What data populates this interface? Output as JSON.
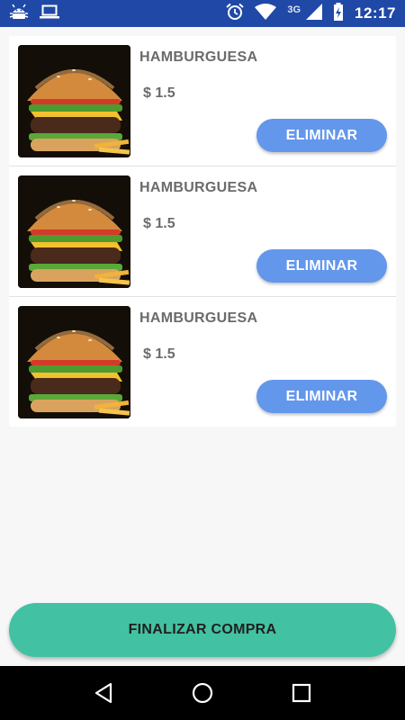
{
  "status_bar": {
    "time": "12:17",
    "network": "3G",
    "icons": [
      "android-debug-icon",
      "laptop-icon",
      "alarm-icon",
      "wifi-icon",
      "signal-icon",
      "battery-icon"
    ]
  },
  "cart": {
    "items": [
      {
        "name": "HAMBURGUESA",
        "price": "$ 1.5",
        "image": "hamburger-image",
        "remove_label": "ELIMINAR"
      },
      {
        "name": "HAMBURGUESA",
        "price": "$ 1.5",
        "image": "hamburger-image",
        "remove_label": "ELIMINAR"
      },
      {
        "name": "HAMBURGUESA",
        "price": "$ 1.5",
        "image": "hamburger-image",
        "remove_label": "ELIMINAR"
      }
    ]
  },
  "checkout": {
    "label": "FINALIZAR COMPRA"
  },
  "nav_bar": {
    "icons": [
      "back-icon",
      "home-icon",
      "recents-icon"
    ]
  },
  "colors": {
    "status_bar": "#1f48a7",
    "remove_button": "#6397ec",
    "checkout_button": "#42c2a2",
    "background": "#f7f7f7"
  }
}
